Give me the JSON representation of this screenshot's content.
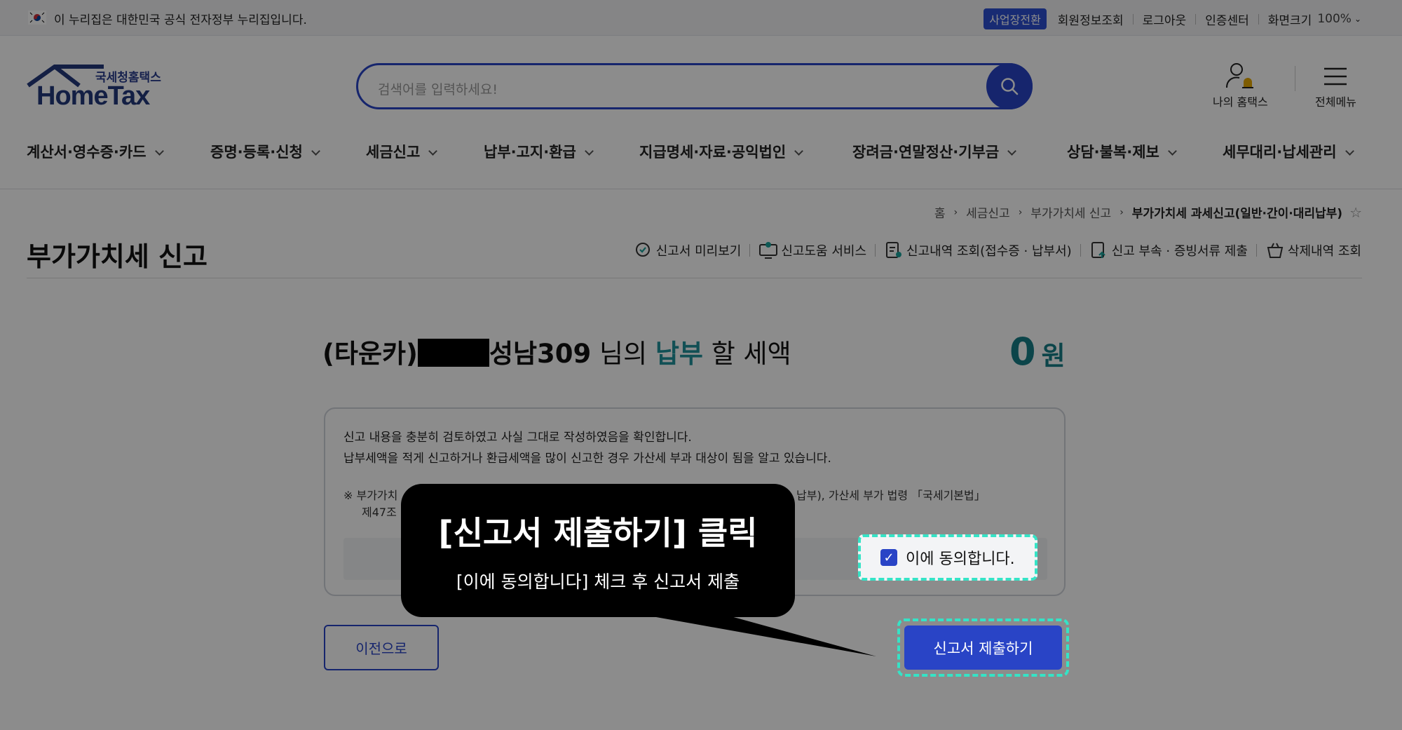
{
  "gov_notice": "이 누리집은 대한민국 공식 전자정부 누리집입니다.",
  "util": {
    "biz_switch": "사업장전환",
    "links": [
      "회원정보조회",
      "로그아웃",
      "인증센터"
    ],
    "font_size_label": "화면크기",
    "font_size_value": "100%"
  },
  "logo": {
    "sub": "국세청홈택스",
    "main": "HomeTax"
  },
  "search": {
    "placeholder": "검색어를 입력하세요!"
  },
  "header_tools": {
    "my_hometax": "나의 홈택스",
    "all_menu": "전체메뉴"
  },
  "gnb": [
    "계산서·영수증·카드",
    "증명·등록·신청",
    "세금신고",
    "납부·고지·환급",
    "지급명세·자료·공익법인",
    "장려금·연말정산·기부금",
    "상담·불복·제보",
    "세무대리·납세관리"
  ],
  "breadcrumb": [
    "홈",
    "세금신고",
    "부가가치세 신고",
    "부가가치세 과세신고(일반·간이·대리납부)"
  ],
  "page_title": "부가가치세 신고",
  "page_tools": [
    "신고서 미리보기",
    "신고도움 서비스",
    "신고내역 조회(접수증 · 납부서)",
    "신고 부속 · 증빙서류 제출",
    "삭제내역 조회"
  ],
  "tax": {
    "name_prefix": "(타운카)",
    "name_suffix": "성남309",
    "honorific": " 님의 ",
    "action": "납부",
    "tail": " 할 세액",
    "amount": "0",
    "unit": "원"
  },
  "confirm": {
    "line1": "신고 내용을 충분히 검토하였고 사실 그대로 작성하였음을 확인합니다.",
    "line2": "납부세액을 적게 신고하거나 환급세액을 많이 신고한 경우 가산세 부과 대상이 됨을 알고 있습니다.",
    "note_start": "※ 부가가치",
    "note_end": "납부), 가산세 부가 법령 「국세기본법」",
    "note_line2": "제47조",
    "agree_label": "이에 동의합니다.",
    "agree_checked": true
  },
  "buttons": {
    "prev": "이전으로",
    "submit": "신고서 제출하기"
  },
  "callout": {
    "title": "[신고서 제출하기] 클릭",
    "subtitle": "[이에 동의합니다] 체크 후 신고서 제출"
  },
  "colors": {
    "brand": "#2944c6",
    "highlight": "#35e3c6",
    "amount": "#177f88"
  }
}
